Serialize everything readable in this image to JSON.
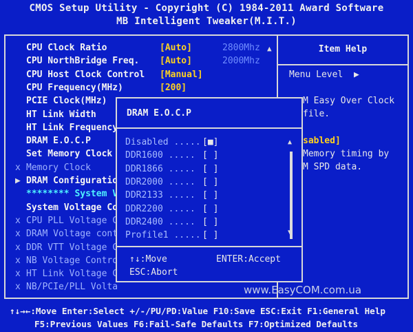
{
  "header": {
    "line1": "CMOS Setup Utility - Copyright (C) 1984-2011 Award Software",
    "line2": "MB Intelligent Tweaker(M.I.T.)"
  },
  "menu": [
    {
      "marker": "",
      "label": "CPU Clock Ratio",
      "value": "[Auto]",
      "extra": "2800Mhz",
      "dim": false
    },
    {
      "marker": "",
      "label": "CPU NorthBridge Freq.",
      "value": "[Auto]",
      "extra": "2000Mhz",
      "dim": false
    },
    {
      "marker": "",
      "label": "CPU Host Clock Control",
      "value": "[Manual]",
      "extra": "",
      "dim": false
    },
    {
      "marker": "",
      "label": "CPU Frequency(MHz)",
      "value": "[200]",
      "extra": "",
      "dim": false
    },
    {
      "marker": "",
      "label": "PCIE Clock(MHz)",
      "value": "",
      "extra": "",
      "dim": false
    },
    {
      "marker": "",
      "label": "HT Link Width",
      "value": "",
      "extra": "",
      "dim": false
    },
    {
      "marker": "",
      "label": "HT Link Frequency",
      "value": "",
      "extra": "",
      "dim": false
    },
    {
      "marker": "",
      "label": "DRAM E.O.C.P",
      "value": "",
      "extra": "",
      "dim": false
    },
    {
      "marker": "",
      "label": "Set Memory Clock",
      "value": "",
      "extra": "",
      "dim": false
    },
    {
      "marker": "x",
      "label": "Memory Clock",
      "value": "",
      "extra": "",
      "dim": true
    },
    {
      "marker": "▶",
      "label": "DRAM Configuratio",
      "value": "",
      "extra": "",
      "dim": false
    },
    {
      "marker": "",
      "label": "******** System V",
      "value": "",
      "extra": "",
      "dim": false,
      "sys": true
    },
    {
      "marker": "",
      "label": "System Voltage Co",
      "value": "",
      "extra": "",
      "dim": false
    },
    {
      "marker": "x",
      "label": "CPU PLL Voltage C",
      "value": "",
      "extra": "",
      "dim": true
    },
    {
      "marker": "x",
      "label": "DRAM Voltage cont",
      "value": "",
      "extra": "",
      "dim": true
    },
    {
      "marker": "x",
      "label": "DDR VTT Voltage C",
      "value": "",
      "extra": "",
      "dim": true
    },
    {
      "marker": "x",
      "label": "NB Voltage Contro",
      "value": "",
      "extra": "",
      "dim": true
    },
    {
      "marker": "x",
      "label": "HT Link Voltage C",
      "value": "",
      "extra": "",
      "dim": true
    },
    {
      "marker": "x",
      "label": "NB/PCIe/PLL Volta",
      "value": "",
      "extra": "",
      "dim": true
    }
  ],
  "help": {
    "title": "Item Help",
    "menu_level": "Menu Level",
    "menu_level_arrow": "▶",
    "lines": [
      {
        "text": "M Easy Over Clock",
        "yellow": false
      },
      {
        "text": "file.",
        "yellow": false
      },
      {
        "text": "sabled]",
        "yellow": true
      },
      {
        "text": " Memory timing by",
        "yellow": false
      },
      {
        "text": "M SPD data.",
        "yellow": false
      }
    ]
  },
  "popup": {
    "title": "DRAM E.O.C.P",
    "options": [
      {
        "label": "Disabled .....",
        "check": "[■]"
      },
      {
        "label": "DDR1600  .....",
        "check": "[ ]"
      },
      {
        "label": "DDR1866  .....",
        "check": "[ ]"
      },
      {
        "label": "DDR2000  .....",
        "check": "[ ]"
      },
      {
        "label": "DDR2133  .....",
        "check": "[ ]"
      },
      {
        "label": "DDR2200  .....",
        "check": "[ ]"
      },
      {
        "label": "DDR2400  .....",
        "check": "[ ]"
      },
      {
        "label": "Profile1 .....",
        "check": "[ ]"
      }
    ],
    "key_move": "↑↓:Move",
    "key_accept": "ENTER:Accept",
    "key_abort": "ESC:Abort"
  },
  "watermark": "www.EasyCOM.com.ua",
  "footer": {
    "line1": "↑↓→←:Move  Enter:Select  +/-/PU/PD:Value  F10:Save  ESC:Exit  F1:General Help",
    "line2": "F5:Previous Values  F6:Fail-Safe Defaults  F7:Optimized Defaults"
  },
  "colors": {
    "background": "#0a1ec8",
    "value": "#ffd21f",
    "dim": "#9fb2ff",
    "system": "#4ef0ff"
  }
}
